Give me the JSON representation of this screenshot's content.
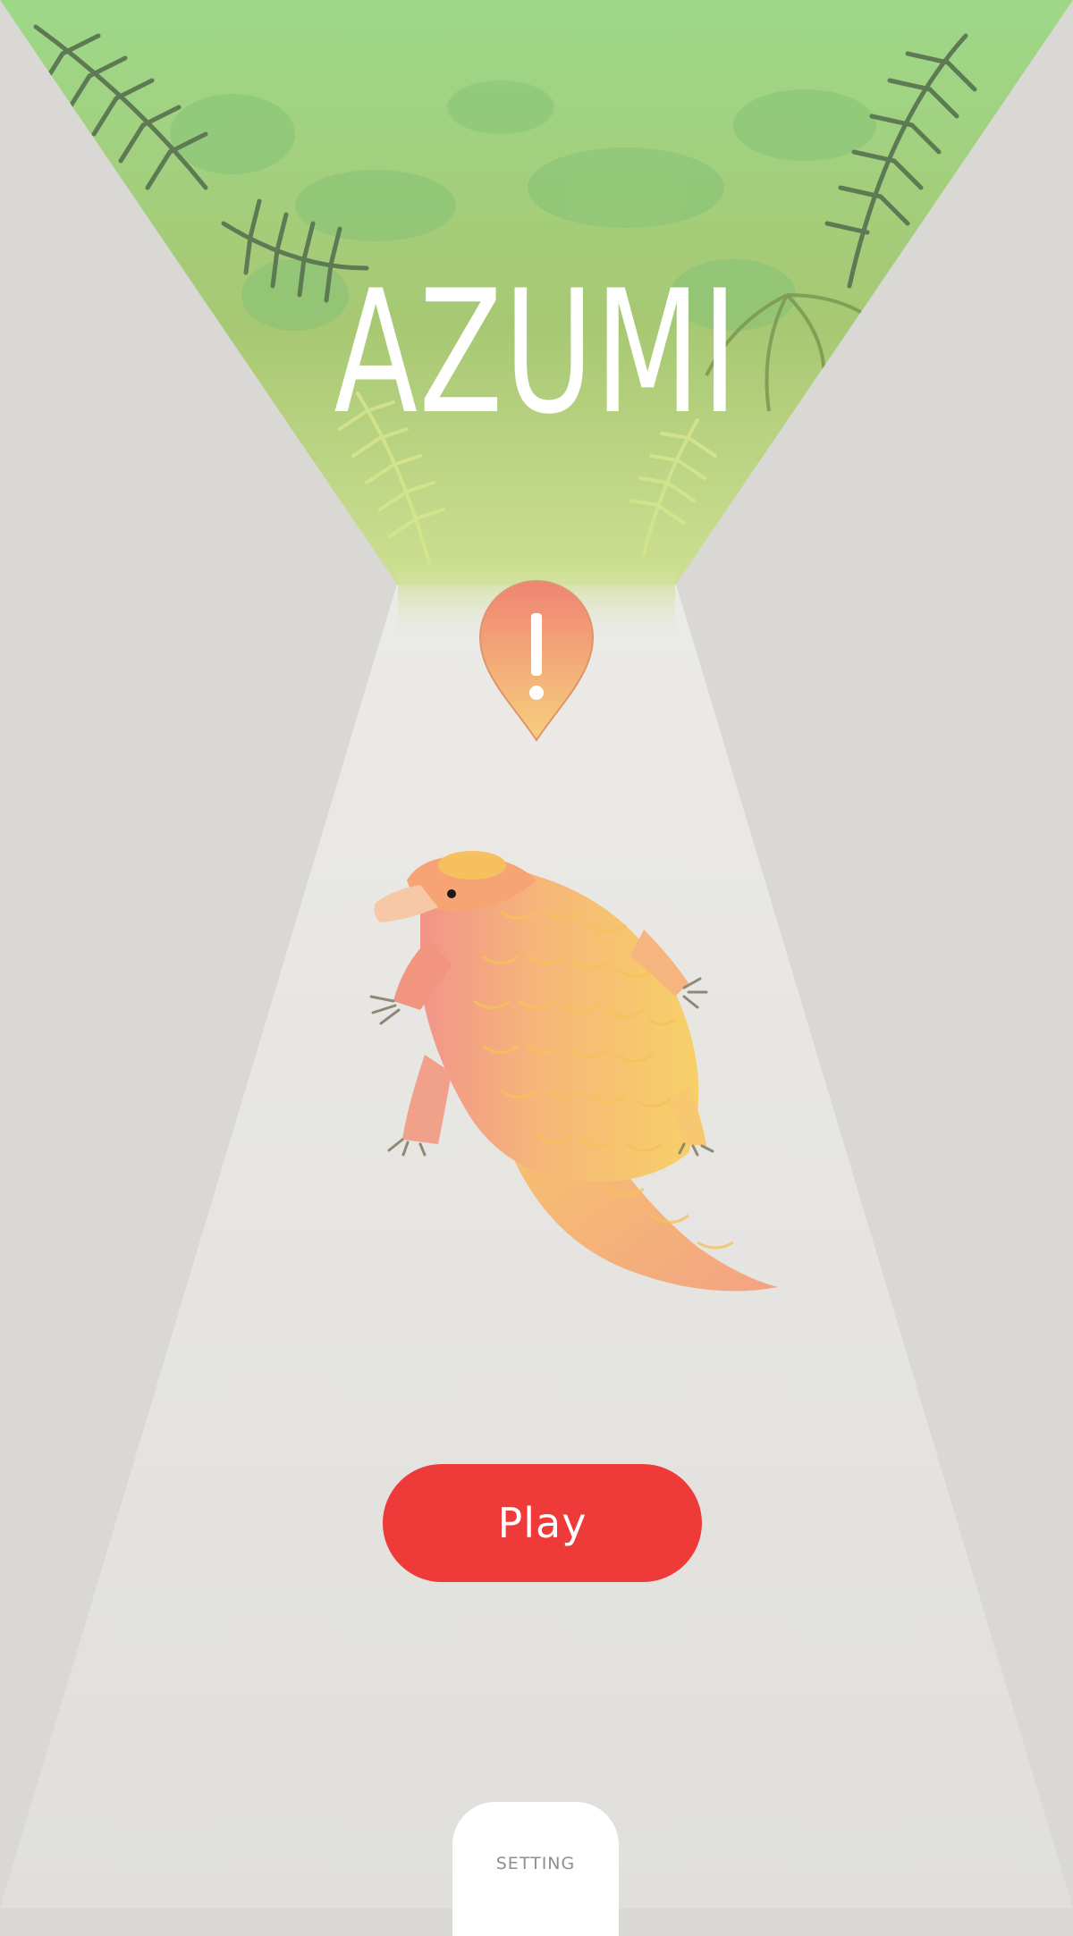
{
  "app": {
    "title": "AZUMI"
  },
  "marker": {
    "icon": "exclamation-pin-icon",
    "symbol": "!",
    "color_top": "#f08472",
    "color_bottom": "#f6d07e"
  },
  "character": {
    "icon": "pangolin-illustration"
  },
  "actions": {
    "play_label": "Play",
    "setting_label": "SETTING"
  },
  "colors": {
    "background": "#d9d8d5",
    "path": "#e6e5e2",
    "forest_top": "#9dd889",
    "forest_bottom": "#c6dc92",
    "play_button": "#ee3a38"
  }
}
